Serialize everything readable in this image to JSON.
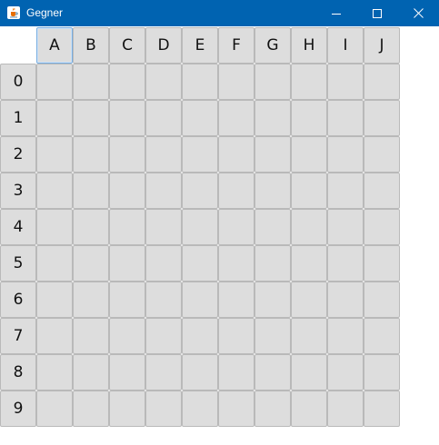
{
  "window": {
    "title": "Gegner",
    "app_icon": "java-coffee-cup-icon",
    "controls": [
      "minimize-icon",
      "maximize-icon",
      "close-icon"
    ]
  },
  "board": {
    "columns": [
      "A",
      "B",
      "C",
      "D",
      "E",
      "F",
      "G",
      "H",
      "I",
      "J"
    ],
    "rows": [
      "0",
      "1",
      "2",
      "3",
      "4",
      "5",
      "6",
      "7",
      "8",
      "9"
    ],
    "selected_header": "A"
  }
}
